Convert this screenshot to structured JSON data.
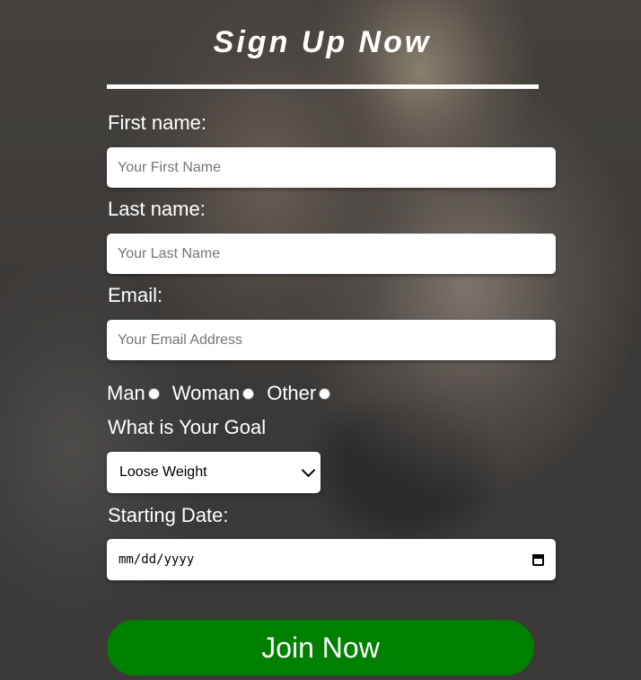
{
  "form": {
    "title": "Sign Up Now",
    "first_name": {
      "label": "First name:",
      "placeholder": "Your First Name",
      "value": ""
    },
    "last_name": {
      "label": "Last name:",
      "placeholder": "Your Last Name",
      "value": ""
    },
    "email": {
      "label": "Email:",
      "placeholder": "Your Email Address",
      "value": ""
    },
    "gender_options": [
      {
        "label": "Man",
        "checked": false
      },
      {
        "label": "Woman",
        "checked": false
      },
      {
        "label": "Other",
        "checked": false
      }
    ],
    "goal": {
      "label": "What is Your Goal",
      "selected": "Loose Weight"
    },
    "start_date": {
      "label": "Starting Date:",
      "placeholder": "mm/dd/yyyy"
    },
    "submit_label": "Join Now"
  },
  "colors": {
    "button_bg": "#008000",
    "text": "#ffffff",
    "input_bg": "#ffffff"
  },
  "icons": {
    "select_arrow": "chevron-down-icon",
    "date_picker": "calendar-icon"
  }
}
